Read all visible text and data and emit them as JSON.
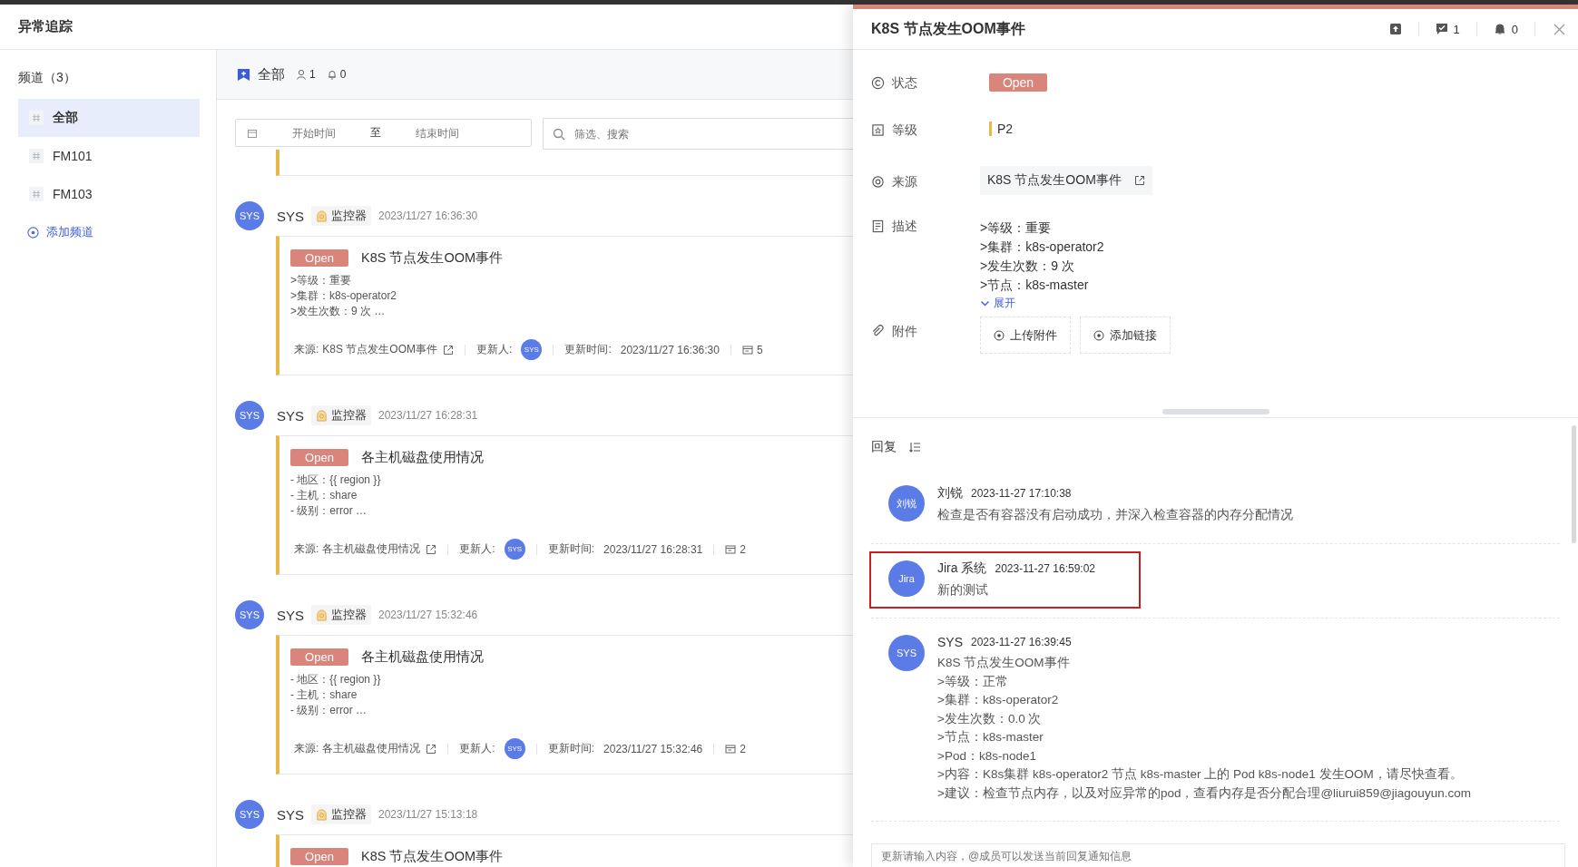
{
  "app": {
    "title": "异常追踪"
  },
  "sidebar": {
    "heading": "频道（3）",
    "channels": [
      {
        "label": "全部",
        "selected": true
      },
      {
        "label": "FM101",
        "selected": false
      },
      {
        "label": "FM103",
        "selected": false
      }
    ],
    "add_button": "添加频道"
  },
  "main": {
    "tab": "全部",
    "members": "1",
    "notifications": "0",
    "filters": {
      "start_placeholder": "开始时间",
      "separator": "至",
      "end_placeholder": "结束时间",
      "search_placeholder": "筛选、搜索"
    },
    "events": [
      {
        "author": "SYS",
        "avatar": "SYS",
        "tag": "监控器",
        "time": "2023/11/27 16:36:30",
        "status": "Open",
        "title": "K8S 节点发生OOM事件",
        "lines": [
          ">等级：重要",
          ">集群：k8s-operator2",
          ">发生次数：9 次  …"
        ],
        "footer": {
          "source_label": "来源:",
          "source": "K8S 节点发生OOM事件",
          "updater_label": "更新人:",
          "updater_avatar": "SYS",
          "update_time_label": "更新时间:",
          "update_time": "2023/11/27 16:36:30",
          "count": "5"
        }
      },
      {
        "author": "SYS",
        "avatar": "SYS",
        "tag": "监控器",
        "time": "2023/11/27 16:28:31",
        "status": "Open",
        "title": "各主机磁盘使用情况",
        "lines": [
          "- 地区：{{ region }}",
          "- 主机：share",
          "- 级别：error  …"
        ],
        "footer": {
          "source_label": "来源:",
          "source": "各主机磁盘使用情况",
          "updater_label": "更新人:",
          "updater_avatar": "SYS",
          "update_time_label": "更新时间:",
          "update_time": "2023/11/27 16:28:31",
          "count": "2"
        }
      },
      {
        "author": "SYS",
        "avatar": "SYS",
        "tag": "监控器",
        "time": "2023/11/27 15:32:46",
        "status": "Open",
        "title": "各主机磁盘使用情况",
        "lines": [
          "- 地区：{{ region }}",
          "- 主机：share",
          "- 级别：error  …"
        ],
        "footer": {
          "source_label": "来源:",
          "source": "各主机磁盘使用情况",
          "updater_label": "更新人:",
          "updater_avatar": "SYS",
          "update_time_label": "更新时间:",
          "update_time": "2023/11/27 15:32:46",
          "count": "2"
        }
      },
      {
        "author": "SYS",
        "avatar": "SYS",
        "tag": "监控器",
        "time": "2023/11/27 15:13:18",
        "status": "Open",
        "title": "K8S 节点发生OOM事件"
      }
    ]
  },
  "drawer": {
    "title": "K8S 节点发生OOM事件",
    "comments": "1",
    "notifications": "0",
    "fields": [
      {
        "kind": "status",
        "label": "状态",
        "value": "Open"
      },
      {
        "kind": "level",
        "label": "等级",
        "value": "P2"
      },
      {
        "kind": "source",
        "label": "来源",
        "value": "K8S 节点发生OOM事件"
      },
      {
        "kind": "description",
        "label": "描述",
        "lines": [
          ">等级：重要",
          ">集群：k8s-operator2",
          ">发生次数：9 次",
          ">节点：k8s-master"
        ],
        "expand": "展开"
      },
      {
        "kind": "attachments",
        "label": "附件",
        "buttons": [
          "上传附件",
          "添加链接"
        ]
      }
    ],
    "replies": {
      "heading": "回复",
      "items": [
        {
          "avatar": "刘锐",
          "name": "刘锐",
          "time": "2023-11-27 17:10:38",
          "highlighted": false,
          "lines": [
            "检查是否有容器没有启动成功，并深入检查容器的内存分配情况"
          ]
        },
        {
          "avatar": "Jira",
          "name": "Jira 系统",
          "time": "2023-11-27 16:59:02",
          "highlighted": true,
          "lines": [
            "新的测试"
          ]
        },
        {
          "avatar": "SYS",
          "name": "SYS",
          "time": "2023-11-27 16:39:45",
          "highlighted": false,
          "lines": [
            "K8S 节点发生OOM事件",
            ">等级：正常",
            ">集群：k8s-operator2",
            ">发生次数：0.0 次",
            ">节点：k8s-master",
            ">Pod：k8s-node1",
            ">内容：K8s集群 k8s-operator2 节点 k8s-master 上的 Pod k8s-node1 发生OOM，请尽快查看。",
            ">建议：检查节点内存，以及对应异常的pod，查看内存是否分配合理@liurui859@jiagouyun.com"
          ]
        }
      ]
    },
    "input": {
      "placeholder": "更新请输入内容，@成员可以发送当前回复通知信息"
    }
  }
}
